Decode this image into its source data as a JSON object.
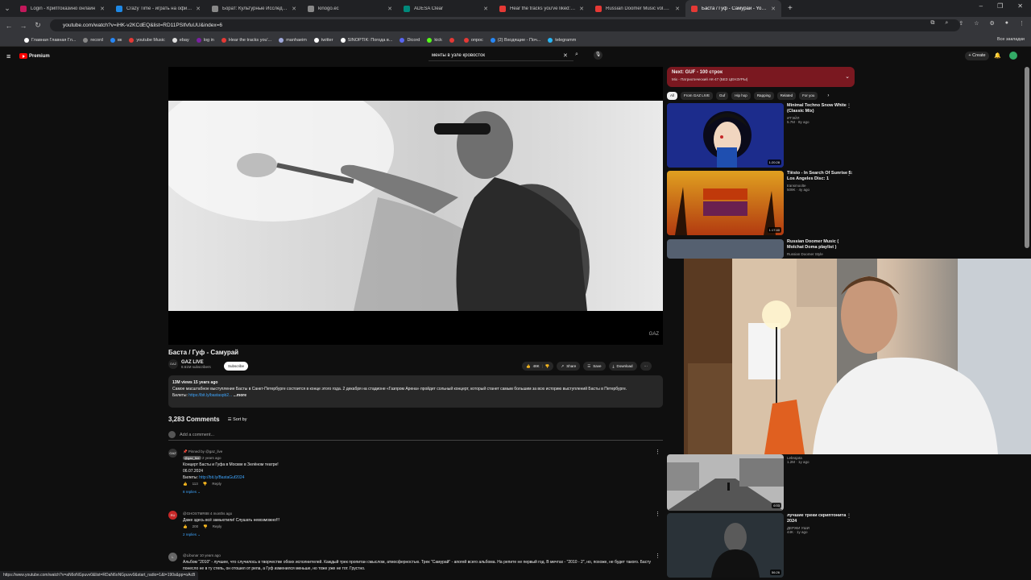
{
  "browser": {
    "tabs": [
      {
        "label": "Login - Криптоказино онлайн",
        "color": "#c2185b",
        "active": false
      },
      {
        "label": "Crazy Time - играть на официа",
        "color": "#1e88e5",
        "active": false
      },
      {
        "label": "Борат: Культурные Исследова",
        "color": "#888888",
        "active": false
      },
      {
        "label": "kinogo.ec",
        "color": "#888888",
        "active": false
      },
      {
        "label": "ADESA Clear",
        "color": "#00897b",
        "active": false
      },
      {
        "label": "Hear the tracks you've liked: on",
        "color": "#e53935",
        "active": false
      },
      {
        "label": "Russian Doomer Music vol.3 (D",
        "color": "#e53935",
        "active": false
      },
      {
        "label": "Баста / Гуф - Самурай - YouTub",
        "color": "#e53935",
        "active": true
      }
    ],
    "new_tab": "+",
    "url": "youtube.com/watch?v=iHK-v2KCdEQ&list=RD11PSIfvfuUU&index=6",
    "bookmarks": [
      {
        "label": "Главная Главная Гл...",
        "color": "#ffffff"
      },
      {
        "label": "record",
        "color": "#888888"
      },
      {
        "label": "вк",
        "color": "#2787f5"
      },
      {
        "label": "youtube Music",
        "color": "#e53935"
      },
      {
        "label": "ebay",
        "color": "#e0e0e0"
      },
      {
        "label": "log in",
        "color": "#7b1fa2"
      },
      {
        "label": "Hear the tracks you'...",
        "color": "#e53935"
      },
      {
        "label": "manhaeim",
        "color": "#9fa8da"
      },
      {
        "label": "twitter",
        "color": "#ffffff"
      },
      {
        "label": "SINOPTIK: Погода в...",
        "color": "#ffffff"
      },
      {
        "label": "Dicord",
        "color": "#5865f2"
      },
      {
        "label": "kick",
        "color": "#53fc18"
      },
      {
        "label": "",
        "color": "#e53935"
      },
      {
        "label": "опрос",
        "color": "#e53935"
      },
      {
        "label": "(2) Входящие - Поч...",
        "color": "#2787f5"
      },
      {
        "label": "telegramm",
        "color": "#29b6f6"
      }
    ],
    "all_bookmarks": "Все закладки",
    "status_url": "https://www.youtube.com/watch?v=aN6oNGpuvv0&list=RDaN6oNGpuvv0&start_radio=1&t=190s&pp=oAcB"
  },
  "youtube": {
    "logo_text": "Premium",
    "search_value": "менты в узле кровосток",
    "create_label": "Create",
    "video": {
      "title": "Баста / Гуф - Самурай",
      "channel": "GAZ LIVE",
      "channel_logo": "GAZ",
      "subscribers": "8.61M subscribers",
      "subscribe_label": "Subscribe",
      "likes": "48K",
      "share_label": "Share",
      "save_label": "Save",
      "download_label": "Download",
      "watermark": "GAZ"
    },
    "description": {
      "meta": "13M views  15 years ago",
      "text": "Самое масштабное выступление Басты в Санкт-Петербурге состоится в конце этого года. 2 декабря на стадионе «Газпром Арена» пройдет сольный  концерт, который станет самым большим за всю историю выступлений Басты в Петербурге.",
      "tickets_label": "Билеты:",
      "tickets_link": "https://bit.ly/bastaspb2...",
      "more": "...more"
    },
    "comments": {
      "count": "3,283 Comments",
      "sort_label": "Sort by",
      "add_placeholder": "Add a comment...",
      "items": [
        {
          "pinned": "Pinned by @gaz_live",
          "author": "@gaz_live",
          "time": "2 years ago",
          "avatar": "GAZ",
          "line1": "Концерт Басты и Гуфа в Москве в Зелёном театре!",
          "line2": "06.07.2024",
          "label3": "Билеты:",
          "link3": "http://bit.ly/BastaGuf2024",
          "likes": "113",
          "reply": "Reply",
          "replies": "8 replies"
        },
        {
          "author": "@GHOSTMR88",
          "time": "4 months ago",
          "avatar": "RU",
          "line1": "Даже здесь всё замьютили! Слушать невозможно!!!",
          "likes": "200",
          "reply": "Reply",
          "replies": "2 replies"
        },
        {
          "author": "@Libunar",
          "time": "10 years ago",
          "avatar": "L",
          "line1": "Альбом \"2010\" - лучшее, что случилось в творчестве обоих исполнителей. Каждый трек пропитан смыслом, атмосферностью. Трек \"Самурай\" - апогей всего альбома. На репите не первый год. В мечтах - \"2010 - 2\", но, похоже, не будет такого. Басту понесло не в ту степь, он отошел от репа, а Гуф изменился меньше, но тоже уже не тот. Грустно."
        }
      ]
    },
    "sidebar": {
      "mix_title": "Next: GUF - 100 строк",
      "mix_sub": "Mix - Патриотический АК-47 (БЕЗ ЦЕНЗУРЫ)",
      "chips": [
        "All",
        "From GAZ LIVE",
        "Guf",
        "Hip hop",
        "Rapping",
        "Related",
        "For you"
      ],
      "recs": [
        {
          "title": "Minimal Techno Snow White (Classic Mix)",
          "channel": "ИТЭЙЛ",
          "meta": "5.7M · 8y ago",
          "duration": "1:20:28"
        },
        {
          "title": "Tiësto - In Search Of Sunrise 5: Los Angeles Disc: 1",
          "channel": "transmoolte",
          "meta": "509K · 4y ago",
          "duration": "1:17:40"
        },
        {
          "title": "Russian Doomer Music ( Molchat Doma playlist )",
          "channel": "Russian Doomer Style",
          "meta": "",
          "duration": ""
        },
        {
          "title": "",
          "channel": "Lebrajota",
          "meta": "1.2M · 1y ago",
          "duration": "6:03"
        },
        {
          "title": "лучшие треки скриптонита 2024",
          "channel": "ДЕРЖИ УШИ",
          "meta": "44K · 1y ago",
          "duration": "56:26"
        }
      ]
    }
  }
}
